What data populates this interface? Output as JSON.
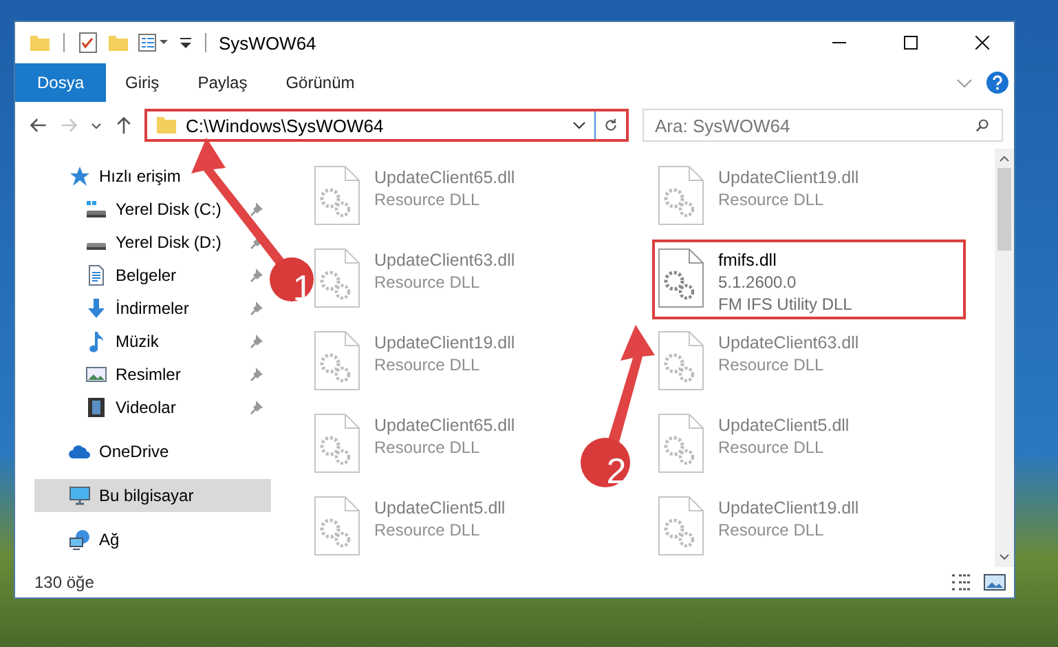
{
  "window": {
    "title": "SysWOW64"
  },
  "ribbon": {
    "tabs": [
      {
        "label": "Dosya",
        "selected": true
      },
      {
        "label": "Giriş",
        "selected": false
      },
      {
        "label": "Paylaş",
        "selected": false
      },
      {
        "label": "Görünüm",
        "selected": false
      }
    ]
  },
  "address_bar": {
    "path": "C:\\Windows\\SysWOW64",
    "highlighted": true
  },
  "search": {
    "placeholder": "Ara: SysWOW64"
  },
  "sidebar": {
    "items": [
      {
        "label": "Hızlı erişim",
        "kind": "star",
        "selected": false,
        "children": [
          {
            "label": "Yerel Disk (C:)",
            "kind": "system-drive",
            "pinned": true,
            "selected": false
          },
          {
            "label": "Yerel Disk (D:)",
            "kind": "drive",
            "pinned": true,
            "selected": false
          },
          {
            "label": "Belgeler",
            "kind": "documents",
            "pinned": true,
            "selected": false
          },
          {
            "label": "İndirmeler",
            "kind": "downloads",
            "pinned": true,
            "selected": false
          },
          {
            "label": "Müzik",
            "kind": "music",
            "pinned": true,
            "selected": false
          },
          {
            "label": "Resimler",
            "kind": "pictures",
            "pinned": true,
            "selected": false
          },
          {
            "label": "Videolar",
            "kind": "videos",
            "pinned": true,
            "selected": false
          }
        ]
      },
      {
        "label": "OneDrive",
        "kind": "cloud",
        "selected": false
      },
      {
        "label": "Bu bilgisayar",
        "kind": "computer",
        "selected": true
      },
      {
        "label": "Ağ",
        "kind": "network",
        "selected": false
      }
    ]
  },
  "files": [
    {
      "name": "UpdateClient65.dll",
      "description": "Resource DLL",
      "blurred": true,
      "highlighted": false
    },
    {
      "name": "UpdateClient19.dll",
      "description": "Resource DLL",
      "blurred": true,
      "highlighted": false
    },
    {
      "name": "UpdateClient63.dll",
      "description": "Resource DLL",
      "blurred": true,
      "highlighted": false
    },
    {
      "name": "fmifs.dll",
      "version": "5.1.2600.0",
      "description": "FM IFS Utility DLL",
      "blurred": false,
      "highlighted": true
    },
    {
      "name": "UpdateClient19.dll",
      "description": "Resource DLL",
      "blurred": true,
      "highlighted": false
    },
    {
      "name": "UpdateClient63.dll",
      "description": "Resource DLL",
      "blurred": true,
      "highlighted": false
    },
    {
      "name": "UpdateClient65.dll",
      "description": "Resource DLL",
      "blurred": true,
      "highlighted": false
    },
    {
      "name": "UpdateClient5.dll",
      "description": "Resource DLL",
      "blurred": true,
      "highlighted": false
    },
    {
      "name": "UpdateClient5.dll",
      "description": "Resource DLL",
      "blurred": true,
      "highlighted": false
    },
    {
      "name": "UpdateClient19.dll",
      "description": "Resource DLL",
      "blurred": true,
      "highlighted": false
    }
  ],
  "status_bar": {
    "item_count": "130 öğe"
  },
  "annotations": [
    {
      "label": "1"
    },
    {
      "label": "2"
    }
  ]
}
